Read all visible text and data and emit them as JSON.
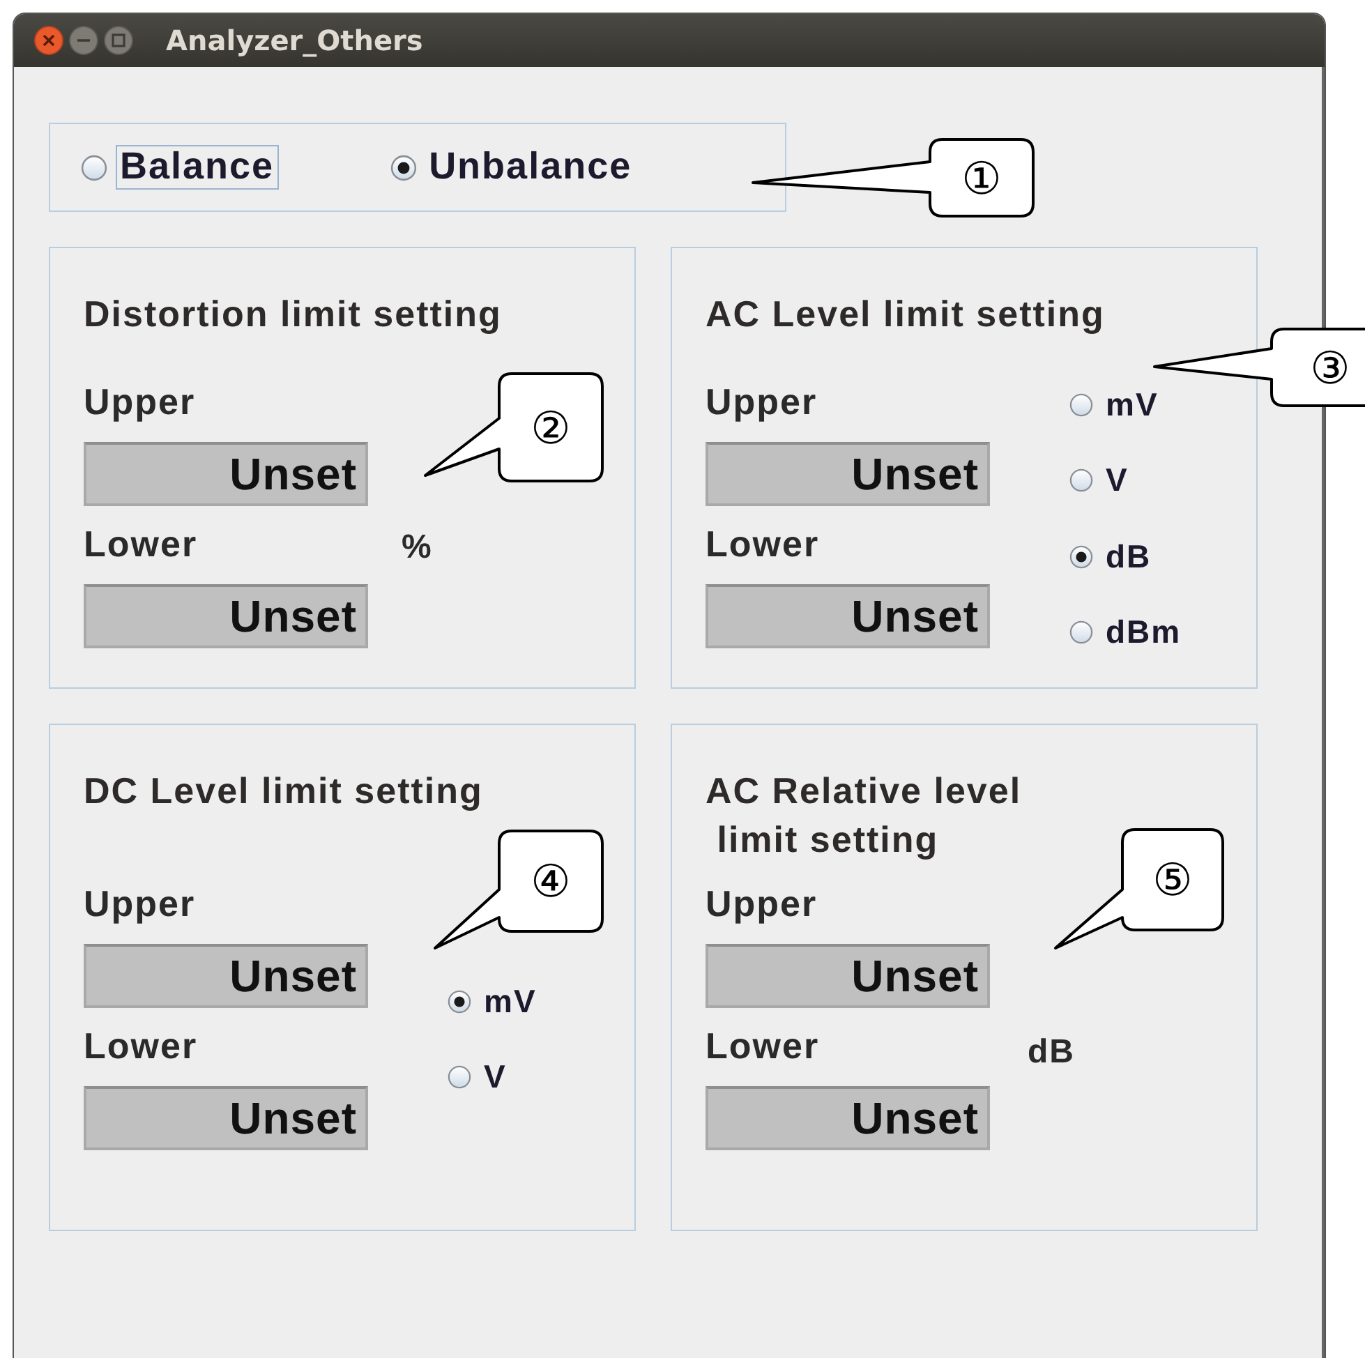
{
  "window": {
    "title": "Analyzer_Others"
  },
  "balance_group": {
    "options": [
      {
        "label": "Balance",
        "selected": false,
        "focused": true
      },
      {
        "label": "Unbalance",
        "selected": true,
        "focused": false
      }
    ]
  },
  "panels": [
    {
      "title_lines": [
        "Distortion limit setting"
      ],
      "kind": "fixed_unit",
      "upper_label": "Upper",
      "upper_value": "Unset",
      "lower_label": "Lower",
      "lower_value": "Unset",
      "unit": "%"
    },
    {
      "title_lines": [
        "AC Level limit setting"
      ],
      "kind": "unit_choice",
      "upper_label": "Upper",
      "upper_value": "Unset",
      "lower_label": "Lower",
      "lower_value": "Unset",
      "units": [
        {
          "label": "mV",
          "selected": false
        },
        {
          "label": "V",
          "selected": false
        },
        {
          "label": "dB",
          "selected": true
        },
        {
          "label": "dBm",
          "selected": false
        }
      ]
    },
    {
      "title_lines": [
        "DC Level limit setting"
      ],
      "kind": "unit_choice",
      "upper_label": "Upper",
      "upper_value": "Unset",
      "lower_label": "Lower",
      "lower_value": "Unset",
      "units": [
        {
          "label": "mV",
          "selected": true
        },
        {
          "label": "V",
          "selected": false
        }
      ]
    },
    {
      "title_lines": [
        "AC Relative level",
        "limit setting"
      ],
      "kind": "fixed_unit",
      "upper_label": "Upper",
      "upper_value": "Unset",
      "lower_label": "Lower",
      "lower_value": "Unset",
      "unit": "dB"
    }
  ],
  "callouts": [
    {
      "label": "①"
    },
    {
      "label": "②"
    },
    {
      "label": "③"
    },
    {
      "label": "④"
    },
    {
      "label": "⑤"
    }
  ]
}
